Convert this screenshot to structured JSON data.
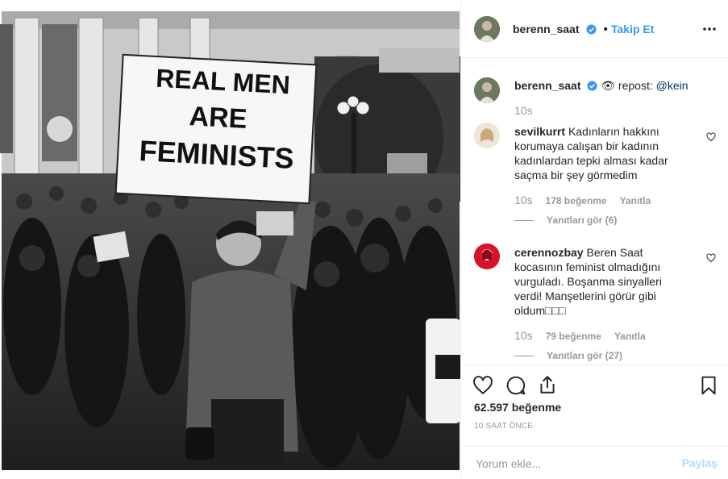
{
  "post": {
    "sign_text": {
      "line1": "REAL MEN",
      "line2": "ARE",
      "line3": "FEMINISTS"
    }
  },
  "header": {
    "username": "berenn_saat",
    "separator": "•",
    "follow_label": "Takip Et"
  },
  "caption": {
    "username": "berenn_saat",
    "text": "👁 repost: ",
    "mention": "@kein",
    "time": "10s"
  },
  "comments": [
    {
      "username": "sevilkurrt",
      "text": "Kadınların hakkını korumaya calışan bir kadının kadınlardan tepki alması kadar saçma bir şey görmedim",
      "time": "10s",
      "likes": "178 beğenme",
      "reply_label": "Yanıtla",
      "view_replies": "Yanıtları gör (6)"
    },
    {
      "username": "cerennozbay",
      "text": "Beren Saat kocasının feminist olmadığını vurguladı. Boşanma sinyalleri verdi! Manşetlerini görür gibi oldum□□□",
      "time": "10s",
      "likes": "79 beğenme",
      "reply_label": "Yanıtla",
      "view_replies": "Yanıtları gör (27)"
    }
  ],
  "stats": {
    "likes": "62.597 beğenme",
    "time_ago": "10 SAAT ÖNCE"
  },
  "composer": {
    "placeholder": "Yorum ekle...",
    "share_label": "Paylaş"
  },
  "colors": {
    "link": "#3897f0",
    "verified": "#3897f0",
    "muted": "#999999",
    "share_disabled": "#b3dbff",
    "text": "#262626"
  },
  "icons": {
    "heart": "heart-icon",
    "comment": "comment-icon",
    "share": "share-icon",
    "bookmark": "bookmark-icon",
    "more": "more-icon",
    "verified": "verified-badge-icon"
  }
}
